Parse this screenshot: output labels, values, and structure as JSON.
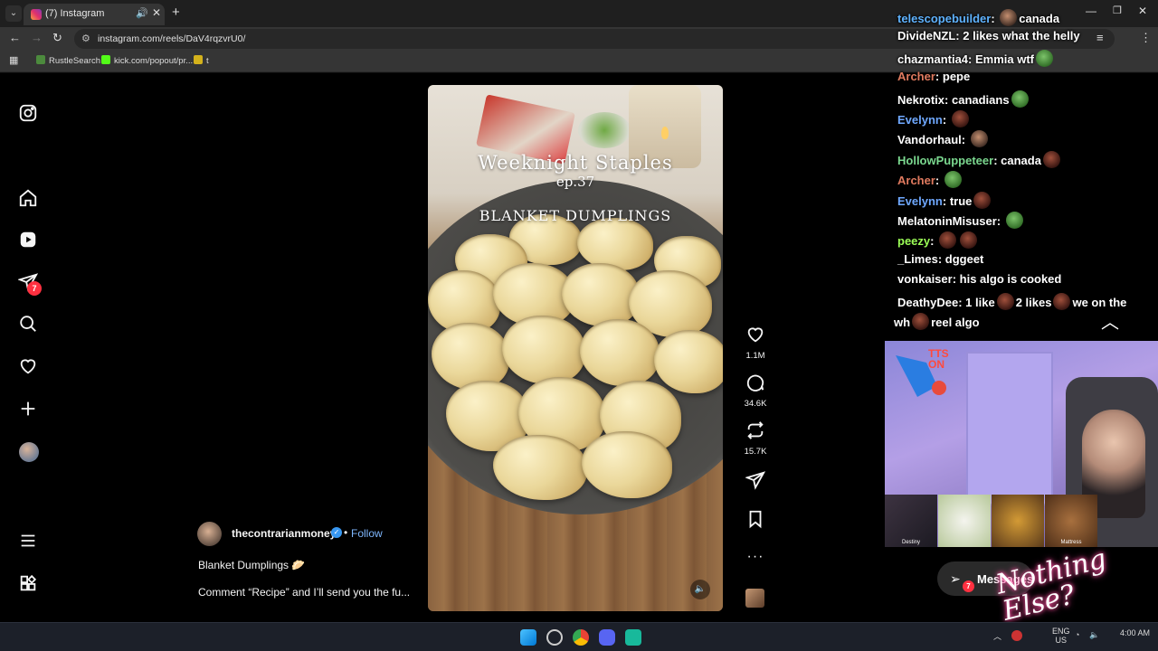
{
  "browser": {
    "tab_title": "(7) Instagram",
    "url": "instagram.com/reels/DaV4rqzvrU0/",
    "bookmarks": [
      "RustleSearch",
      "kick.com/popout/pr...",
      "t"
    ]
  },
  "nav": {
    "notifications_badge": "7"
  },
  "video": {
    "title_line1": "Weeknight Staples",
    "title_line2": "ep.37",
    "title_line3": "BLANKET DUMPLINGS"
  },
  "actions": {
    "likes": "1.1M",
    "comments": "34.6K",
    "reposts": "15.7K"
  },
  "post": {
    "author": "thecontrarianmoney",
    "follow_label": "Follow",
    "caption": "Blanket Dumplings 🥟",
    "caption_more": "Comment “Recipe” and I’ll send you the fu..."
  },
  "chat": [
    {
      "user": "telescopebuilder",
      "color": "#5fb3ff",
      "text": "canada",
      "emote_before": "face"
    },
    {
      "user": "DivideNZL",
      "color": "#ffffff",
      "text": "2 likes what the helly"
    },
    {
      "user": "chazmantia4",
      "color": "#ffffff",
      "text": "Emmia wtf",
      "emote_after": "frog"
    },
    {
      "user": "Archer",
      "color": "#e07a5f",
      "text": "pepe"
    },
    {
      "user": "Nekrotix",
      "color": "#ffffff",
      "text": "canadians",
      "emote_after": "frog"
    },
    {
      "user": "Evelynn",
      "color": "#6fa8ff",
      "text": "",
      "emote_after": "brown"
    },
    {
      "user": "Vandorhaul",
      "color": "#ffffff",
      "text": "",
      "emote_after": "face"
    },
    {
      "user": "HollowPuppeteer",
      "color": "#7bd88f",
      "text": "canada",
      "emote_after": "brown"
    },
    {
      "user": "Archer",
      "color": "#e07a5f",
      "text": "",
      "emote_after": "frog"
    },
    {
      "user": "Evelynn",
      "color": "#6fa8ff",
      "text": "true",
      "emote_after": "brown"
    },
    {
      "user": "MelatoninMisuser",
      "color": "#ffffff",
      "text": "",
      "emote_after": "frog"
    },
    {
      "user": "peezy",
      "color": "#9cff57",
      "text": "",
      "emote_after": "brown2"
    },
    {
      "user": "_Limes",
      "color": "#ffffff",
      "text": "dggeet"
    },
    {
      "user": "vonkaiser",
      "color": "#ffffff",
      "text": "his algo is cooked"
    },
    {
      "user": "DeathyDee",
      "color": "#ffffff",
      "text": "1 like"
    }
  ],
  "chat_extra": {
    "deathy_rest_a": "2 likes",
    "deathy_rest_b": "we on the",
    "deathy_wrap_a": "wh",
    "deathy_wrap_b": "reel algo"
  },
  "webcam": {
    "tts_label": "TTS ON",
    "thumbs": [
      "Destiny",
      "",
      "",
      "Mattress"
    ]
  },
  "messages": {
    "label": "Messages",
    "badge": "7"
  },
  "overlay_logo": "Nothing Else?",
  "taskbar": {
    "lang": "ENG",
    "region": "US",
    "time": "4:00 AM"
  },
  "colors": {
    "ig_badge": "#ff3040",
    "follow": "#7fb8ff",
    "verified": "#3897f0"
  }
}
